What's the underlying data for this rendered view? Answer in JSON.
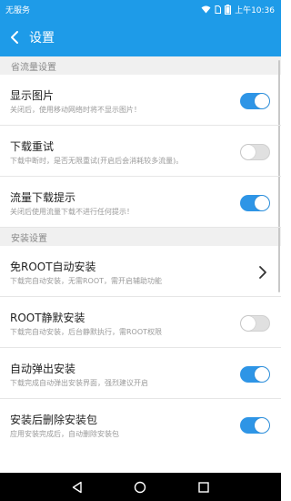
{
  "status_bar": {
    "carrier": "无服务",
    "time": "上午10:36"
  },
  "app_bar": {
    "title": "设置",
    "back_icon": "back-chevron-icon"
  },
  "sections": [
    {
      "header": "省流量设置",
      "items": [
        {
          "title": "显示图片",
          "desc": "关闭后，使用移动网络时将不显示图片！",
          "control": "toggle",
          "on": true
        },
        {
          "title": "下载重试",
          "desc": "下载中断时，是否无限重试(开启后会消耗较多流量)。",
          "control": "toggle",
          "on": false
        },
        {
          "title": "流量下载提示",
          "desc": "关闭后使用流量下载不进行任何提示！",
          "control": "toggle",
          "on": true
        }
      ]
    },
    {
      "header": "安装设置",
      "items": [
        {
          "title": "免ROOT自动安装",
          "desc": "下载完自动安装，无需ROOT，需开启辅助功能",
          "control": "chevron"
        },
        {
          "title": "ROOT静默安装",
          "desc": "下载完自动安装，后台静默执行，需ROOT权限",
          "control": "toggle",
          "on": false
        },
        {
          "title": "自动弹出安装",
          "desc": "下载完成自动弹出安装界面，强烈建议开启",
          "control": "toggle",
          "on": true
        },
        {
          "title": "安装后删除安装包",
          "desc": "应用安装完成后，自动删除安装包",
          "control": "toggle",
          "on": true
        }
      ]
    }
  ],
  "colors": {
    "accent": "#1e9be8",
    "toggle_on": "#2e95e6",
    "toggle_off": "#e0e0e0",
    "section_bg": "#f0f0f0"
  }
}
